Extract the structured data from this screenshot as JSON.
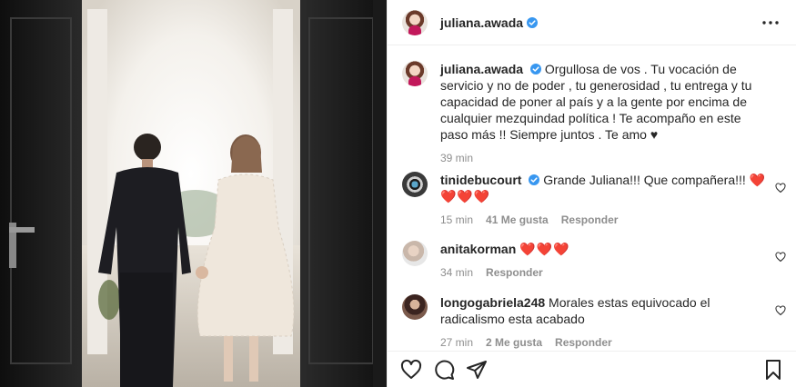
{
  "post": {
    "author": "juliana.awada",
    "caption_username": "juliana.awada",
    "caption_text": "Orgullosa de vos . Tu vocación de servicio y no de poder , tu generosidad , tu entrega y tu capacidad de poner al país y a la gente por encima de cualquier mezquindad política ! Te acompaño en este paso más !! Siempre juntos . Te amo ♥",
    "caption_time": "39 min"
  },
  "comments": [
    {
      "username": "tinidebucourt",
      "text": "Grande Juliana!!! Que compañera!!!",
      "emoji": "❤️❤️❤️❤️",
      "time": "15 min",
      "likes": "41 Me gusta",
      "reply": "Responder"
    },
    {
      "username": "anitakorman",
      "text": "",
      "emoji": "❤️❤️❤️",
      "time": "34 min",
      "reply": "Responder"
    },
    {
      "username": "longogabriela248",
      "text": "Morales estas equivocado el radicalismo esta acabado",
      "time": "27 min",
      "likes": "2 Me gusta",
      "reply": "Responder"
    }
  ],
  "colors": {
    "verified": "#3897f0",
    "heart": "#e0282d",
    "muted": "#8e8e8e",
    "text": "#262626"
  },
  "icons": {
    "more": "more-horizontal-icon",
    "like": "heart-outline-icon",
    "comment": "comment-bubble-icon",
    "share": "paper-plane-icon",
    "save": "bookmark-icon"
  }
}
